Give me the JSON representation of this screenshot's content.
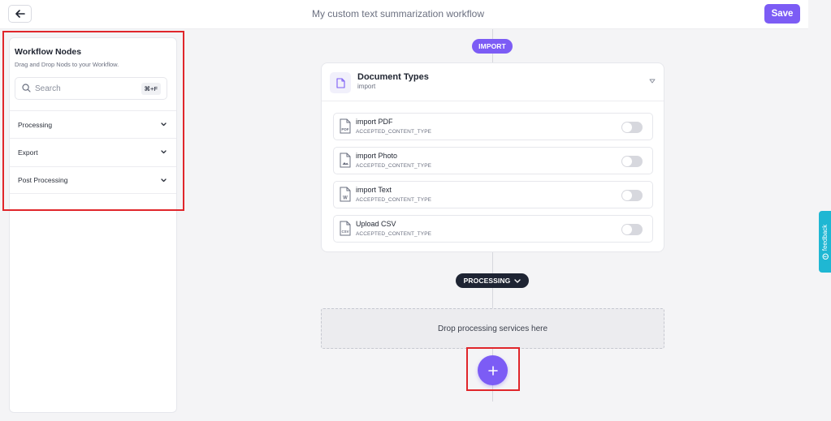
{
  "header": {
    "title": "My custom text summarization workflow",
    "save_label": "Save"
  },
  "sidebar": {
    "title": "Workflow Nodes",
    "subtitle": "Drag and Drop Nods to your Workflow.",
    "search": {
      "placeholder": "Search",
      "shortcut": "⌘+F"
    },
    "items": [
      {
        "label": "Processing"
      },
      {
        "label": "Export"
      },
      {
        "label": "Post Processing"
      }
    ]
  },
  "canvas": {
    "import_label": "IMPORT",
    "processing_label": "PROCESSING",
    "card": {
      "title": "Document Types",
      "subtitle": "import",
      "rows": [
        {
          "name": "import PDF",
          "type": "ACCEPTED_CONTENT_TYPE",
          "icon": "pdf-file-icon",
          "icon_text": "PDF",
          "enabled": false
        },
        {
          "name": "import Photo",
          "type": "ACCEPTED_CONTENT_TYPE",
          "icon": "image-file-icon",
          "icon_text": "",
          "enabled": false
        },
        {
          "name": "import Text",
          "type": "ACCEPTED_CONTENT_TYPE",
          "icon": "word-file-icon",
          "icon_text": "W",
          "enabled": false
        },
        {
          "name": "Upload CSV",
          "type": "ACCEPTED_CONTENT_TYPE",
          "icon": "csv-file-icon",
          "icon_text": "CSV",
          "enabled": false
        }
      ]
    },
    "dropzone_text": "Drop processing services here"
  },
  "feedback": {
    "label": "feedback"
  },
  "colors": {
    "accent": "#7c5cf5",
    "dark_pill": "#1e2433",
    "feedback": "#1fb7d3",
    "highlight": "#e0262b"
  }
}
